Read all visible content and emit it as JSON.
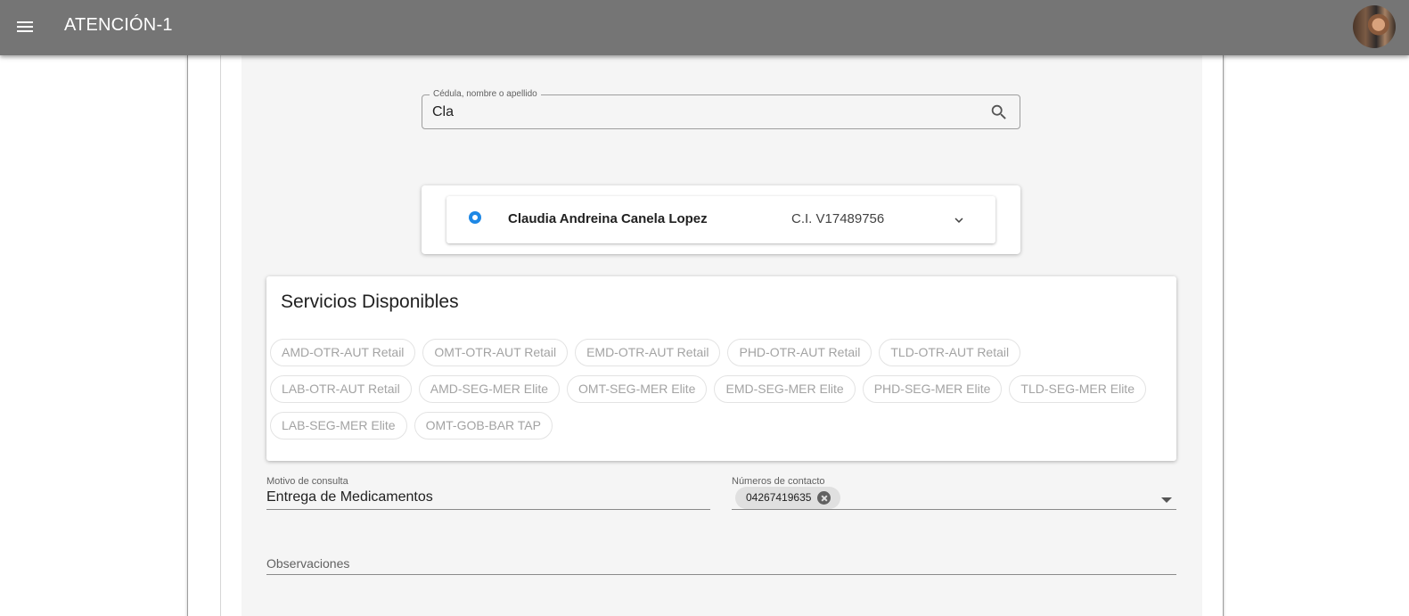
{
  "app": {
    "title": "ATENCIÓN-1",
    "menu_icon": "hamburger-menu-icon",
    "avatar_icon": "user-avatar"
  },
  "search": {
    "label": "Cédula, nombre o apellido",
    "value": "Cla",
    "icon": "search-icon"
  },
  "results": [
    {
      "name": "Claudia Andreina Canela Lopez",
      "id": "C.I. V17489756",
      "selected": true
    }
  ],
  "services": {
    "title": "Servicios Disponibles",
    "chips": [
      "AMD-OTR-AUT Retail",
      "OMT-OTR-AUT Retail",
      "EMD-OTR-AUT Retail",
      "PHD-OTR-AUT Retail",
      "TLD-OTR-AUT Retail",
      "LAB-OTR-AUT Retail",
      "AMD-SEG-MER Elite",
      "OMT-SEG-MER Elite",
      "EMD-SEG-MER Elite",
      "PHD-SEG-MER Elite",
      "TLD-SEG-MER Elite",
      "LAB-SEG-MER Elite",
      "OMT-GOB-BAR TAP"
    ]
  },
  "form": {
    "motivo_label": "Motivo de consulta",
    "motivo_value": "Entrega de Medicamentos",
    "contact_label": "Números de contacto",
    "contact_numbers": [
      "04267419635"
    ],
    "observaciones_placeholder": "Observaciones"
  },
  "colors": {
    "appbar": "#757575",
    "accent": "#1e88e5",
    "content_bg": "#f5f5f5"
  }
}
